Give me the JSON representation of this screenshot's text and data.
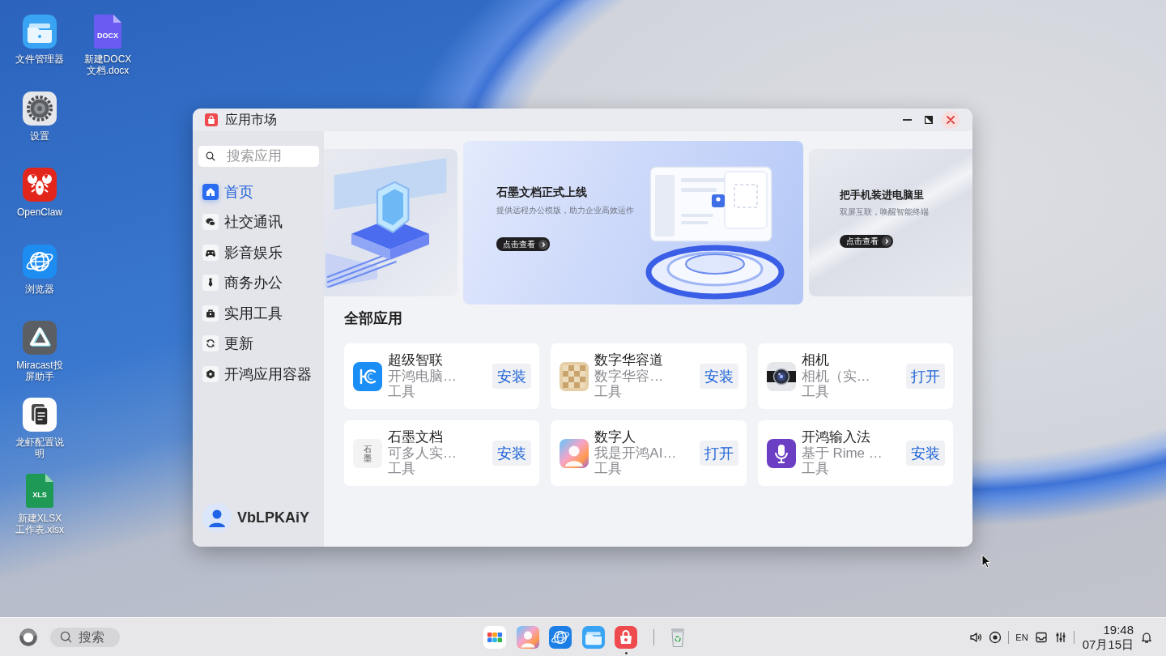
{
  "desktop": {
    "columns": [
      {
        "icons": [
          {
            "kind": "folder",
            "label": "文件管理器"
          },
          {
            "kind": "gear",
            "label": "设置"
          },
          {
            "kind": "claw",
            "label": "OpenClaw"
          },
          {
            "kind": "globe",
            "label": "浏览器"
          },
          {
            "kind": "triangle",
            "label": "Miracast投屏助手"
          },
          {
            "kind": "notes",
            "label": "龙虾配置说明"
          },
          {
            "kind": "sheet",
            "badge": "XLS",
            "label": "新建XLSX工作表.xlsx"
          }
        ]
      },
      {
        "icons": [
          {
            "kind": "doc",
            "badge": "DOCX",
            "label": "新建DOCX文档.docx"
          }
        ]
      }
    ]
  },
  "window": {
    "title": "应用市场",
    "search": {
      "placeholder": "搜索应用"
    },
    "nav": [
      {
        "kind": "home",
        "label": "首页",
        "selected": true
      },
      {
        "kind": "chat",
        "label": "社交通讯",
        "selected": false
      },
      {
        "kind": "gamepad",
        "label": "影音娱乐",
        "selected": false
      },
      {
        "kind": "tie",
        "label": "商务办公",
        "selected": false
      },
      {
        "kind": "toolbox",
        "label": "实用工具",
        "selected": false
      },
      {
        "kind": "refresh",
        "label": "更新",
        "selected": false
      },
      {
        "kind": "container",
        "label": "开鸿应用容器",
        "selected": false
      }
    ],
    "user": {
      "name": "VbLPKAiY"
    },
    "banners": [
      {
        "kind": "shield",
        "selected": false
      },
      {
        "kind": "document",
        "selected": true,
        "title": "石墨文档正式上线",
        "subtitle": "提供远程办公模版，助力企业高效运作",
        "button": "点击查看"
      },
      {
        "kind": "plain",
        "selected": false,
        "title": "把手机装进电脑里",
        "subtitle": "双屏互联，唤醒智能终端",
        "button": "点击查看"
      }
    ],
    "section_title": "全部应用",
    "apps": [
      {
        "kind": "link",
        "name": "超级智联",
        "description": "开鸿电脑…",
        "category": "工具",
        "action": "安装"
      },
      {
        "kind": "puzzle",
        "name": "数字华容道",
        "description": "数字华容…",
        "category": "工具",
        "action": "安装"
      },
      {
        "kind": "camera",
        "name": "相机",
        "description": "相机（实…",
        "category": "工具",
        "action": "打开"
      },
      {
        "kind": "text_logo",
        "logo_text": "石墨",
        "name": "石墨文档",
        "description": "可多人实…",
        "category": "工具",
        "action": "安装"
      },
      {
        "kind": "avatar",
        "name": "数字人",
        "description": "我是开鸿AI…",
        "category": "工具",
        "action": "打开"
      },
      {
        "kind": "mic",
        "name": "开鸿输入法",
        "description": "基于 Rime …",
        "category": "工具",
        "action": "安装"
      }
    ]
  },
  "taskbar": {
    "search": {
      "placeholder": "搜索"
    },
    "apps": [
      {
        "kind": "launcher",
        "running": false
      },
      {
        "kind": "avatar",
        "running": false
      },
      {
        "kind": "globe",
        "running": false
      },
      {
        "kind": "folder",
        "running": false
      },
      {
        "kind": "store",
        "running": true
      }
    ],
    "tray": {
      "language": "EN",
      "time": "19:48",
      "date": "07月15日"
    }
  }
}
